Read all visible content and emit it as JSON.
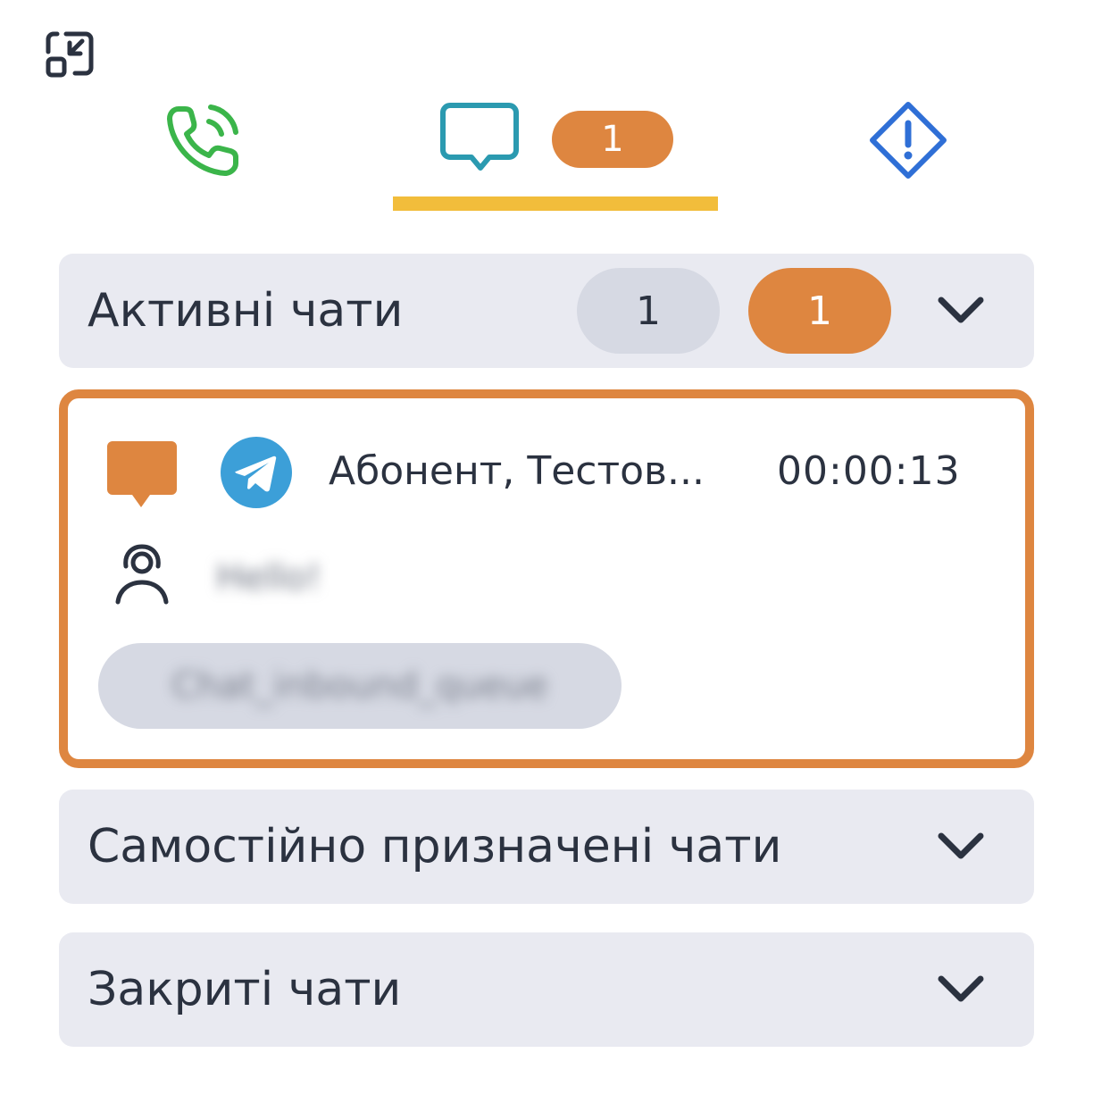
{
  "header": {
    "minimize_icon": "minimize-icon"
  },
  "tabs": {
    "calls": {
      "icon": "phone-icon",
      "color": "#3bb54a"
    },
    "chats": {
      "icon": "chat-bubble-icon",
      "color": "#2b9ab0",
      "badge": "1",
      "badge_color": "#de8640",
      "active": true,
      "underline_color": "#f2bd3b"
    },
    "alerts": {
      "icon": "warning-diamond-icon",
      "color": "#2f6fd6"
    }
  },
  "sections": {
    "active": {
      "title": "Активні чати",
      "count_total": "1",
      "count_unread": "1",
      "expanded": true
    },
    "self_assigned": {
      "title": "Самостійно призначені чати",
      "expanded": false
    },
    "closed": {
      "title": "Закриті чати",
      "expanded": false
    }
  },
  "chat_card": {
    "status_icon": "chat-status-icon",
    "channel_icon": "telegram-icon",
    "name": "Абонент, Тестов...",
    "timer": "00:00:13",
    "agent_icon": "agent-headset-icon",
    "agent_name": "Hello!",
    "queue": "Chat_inbound_queue",
    "border_color": "#de8640"
  }
}
